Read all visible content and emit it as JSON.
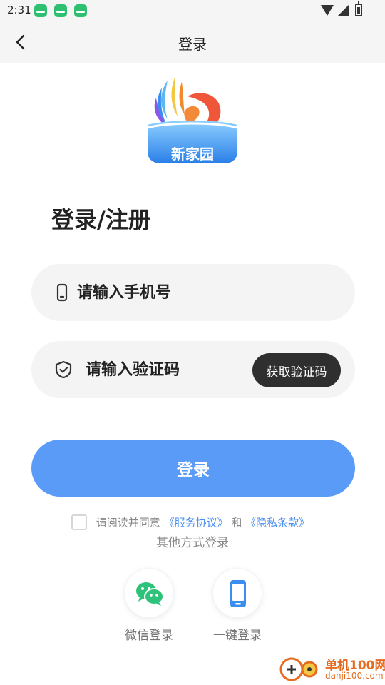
{
  "status_bar": {
    "time": "2:31",
    "app_icons": [
      "app-notification-icon",
      "app-notification-icon",
      "app-notification-icon"
    ],
    "right_icons": [
      "wifi-icon",
      "signal-icon",
      "battery-icon"
    ]
  },
  "navbar": {
    "back_icon": "chevron-left-icon",
    "title": "登录"
  },
  "logo": {
    "caption": "新家园"
  },
  "heading": "登录/注册",
  "phone_field": {
    "icon": "phone-icon",
    "placeholder": "请输入手机号",
    "value": ""
  },
  "code_field": {
    "icon": "shield-icon",
    "placeholder": "请输入验证码",
    "value": "",
    "button_label": "获取验证码"
  },
  "login_button": "登录",
  "agreement": {
    "checked": false,
    "prefix": "请阅读并同意",
    "service_link": "《服务协议》",
    "and": "和",
    "privacy_link": "《隐私条款》"
  },
  "other_methods": {
    "title": "其他方式登录",
    "items": [
      {
        "icon": "wechat-icon",
        "label": "微信登录"
      },
      {
        "icon": "mobile-phone-icon",
        "label": "一键登录"
      }
    ]
  },
  "watermark": {
    "line1": "单机100网",
    "line2": "danji100.com"
  },
  "colors": {
    "accent_blue": "#5a9bf8",
    "link_blue": "#4c8ff2",
    "dark_button": "#2f2f2f",
    "wechat_green": "#2fc27a",
    "field_bg": "#f4f4f4"
  }
}
